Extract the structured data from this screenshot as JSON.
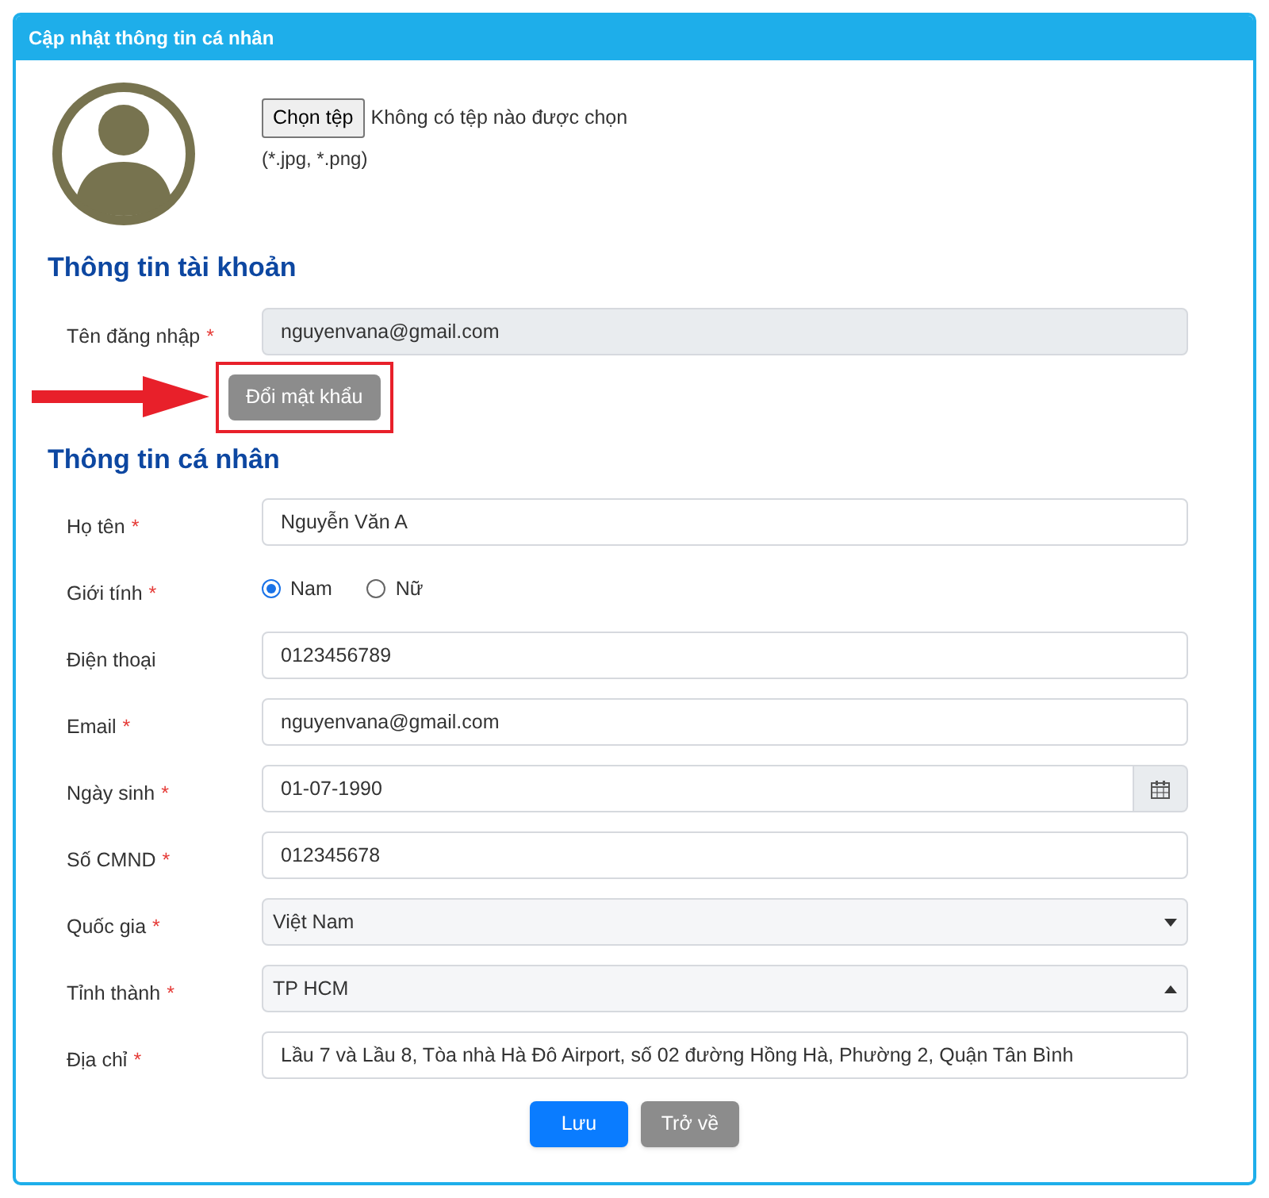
{
  "header": {
    "title": "Cập nhật thông tin cá nhân"
  },
  "upload": {
    "button": "Chọn tệp",
    "status": "Không có tệp nào được chọn",
    "hint": "(*.jpg, *.png)"
  },
  "account": {
    "heading": "Thông tin tài khoản",
    "username": {
      "label": "Tên đăng nhập",
      "required_mark": "*",
      "value": "nguyenvana@gmail.com",
      "disabled": true
    },
    "change_password": "Đổi mật khẩu",
    "highlighted": true
  },
  "personal": {
    "heading": "Thông tin cá nhân",
    "fields": [
      {
        "kind": "text",
        "label": "Họ tên",
        "required_mark": "*",
        "value": "Nguyễn Văn A"
      },
      {
        "kind": "radio",
        "label": "Giới tính",
        "required_mark": "*",
        "options": [
          {
            "label": "Nam",
            "selected": true
          },
          {
            "label": "Nữ",
            "selected": false
          }
        ]
      },
      {
        "kind": "text",
        "label": "Điện thoại",
        "value": "0123456789"
      },
      {
        "kind": "text",
        "label": "Email",
        "required_mark": "*",
        "value": "nguyenvana@gmail.com"
      },
      {
        "kind": "date",
        "label": "Ngày sinh",
        "required_mark": "*",
        "value": "01-07-1990"
      },
      {
        "kind": "text",
        "label": "Số CMND",
        "required_mark": "*",
        "value": "012345678"
      },
      {
        "kind": "select",
        "label": "Quốc gia",
        "required_mark": "*",
        "value": "Việt Nam",
        "expanded": false
      },
      {
        "kind": "select",
        "label": "Tỉnh thành",
        "required_mark": "*",
        "value": "TP HCM",
        "expanded": true
      },
      {
        "kind": "text",
        "label": "Địa chỉ",
        "required_mark": "*",
        "value": "Lầu 7 và Lầu 8, Tòa nhà Hà Đô Airport, số 02 đường Hồng Hà, Phường 2, Quận Tân Bình"
      }
    ]
  },
  "buttons": [
    {
      "kind": "primary",
      "label": "Lưu"
    },
    {
      "kind": "secondary",
      "label": "Trở về"
    }
  ]
}
